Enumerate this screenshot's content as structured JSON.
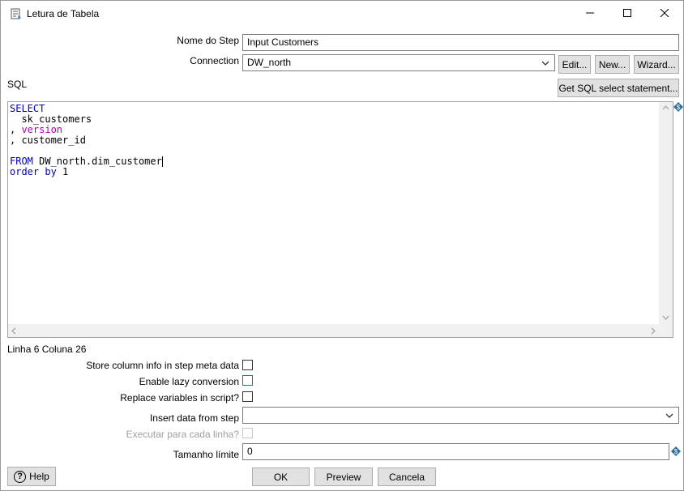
{
  "window": {
    "title": "Letura de Tabela",
    "icon": "table-input-icon",
    "controls": [
      "minimize-icon",
      "maximize-icon",
      "close-icon"
    ]
  },
  "form": {
    "step_name_label": "Nome do Step",
    "step_name_value": "Input Customers",
    "connection_label": "Connection",
    "connection_value": "DW_north",
    "edit_label": "Edit...",
    "new_label": "New...",
    "wizard_label": "Wizard...",
    "sql_label": "SQL",
    "get_sql_label": "Get SQL select statement..."
  },
  "sql": {
    "lines": [
      [
        {
          "t": "SELECT",
          "c": "kw"
        }
      ],
      [
        {
          "t": "  sk_customers",
          "c": ""
        }
      ],
      [
        {
          "t": ", ",
          "c": ""
        },
        {
          "t": "version",
          "c": "kw2"
        }
      ],
      [
        {
          "t": ", customer_id",
          "c": ""
        }
      ],
      [
        {
          "t": "",
          "c": ""
        }
      ],
      [
        {
          "t": "FROM",
          "c": "kw"
        },
        {
          "t": " DW_north.dim_customer",
          "c": ""
        }
      ],
      [
        {
          "t": "order by",
          "c": "kw"
        },
        {
          "t": " 1",
          "c": ""
        }
      ]
    ]
  },
  "status": {
    "position": "Linha 6 Coluna 26"
  },
  "options": {
    "store_column_info_label": "Store column info in step meta data",
    "store_column_info_checked": false,
    "lazy_conversion_label": "Enable lazy conversion",
    "lazy_conversion_checked": false,
    "replace_variables_label": "Replace variables in script?",
    "replace_variables_checked": false,
    "insert_data_label": "Insert data from step",
    "insert_data_value": "",
    "execute_each_row_label": "Executar para cada linha?",
    "execute_each_row_checked": false,
    "limit_label": "Tamanho límite",
    "limit_value": "0"
  },
  "footer": {
    "help_label": "Help",
    "ok_label": "OK",
    "preview_label": "Preview",
    "cancel_label": "Cancela"
  },
  "colors": {
    "keyword": "#0000b8",
    "keyword_alt": "#b000b0",
    "focus_blue": "#0078d7"
  }
}
